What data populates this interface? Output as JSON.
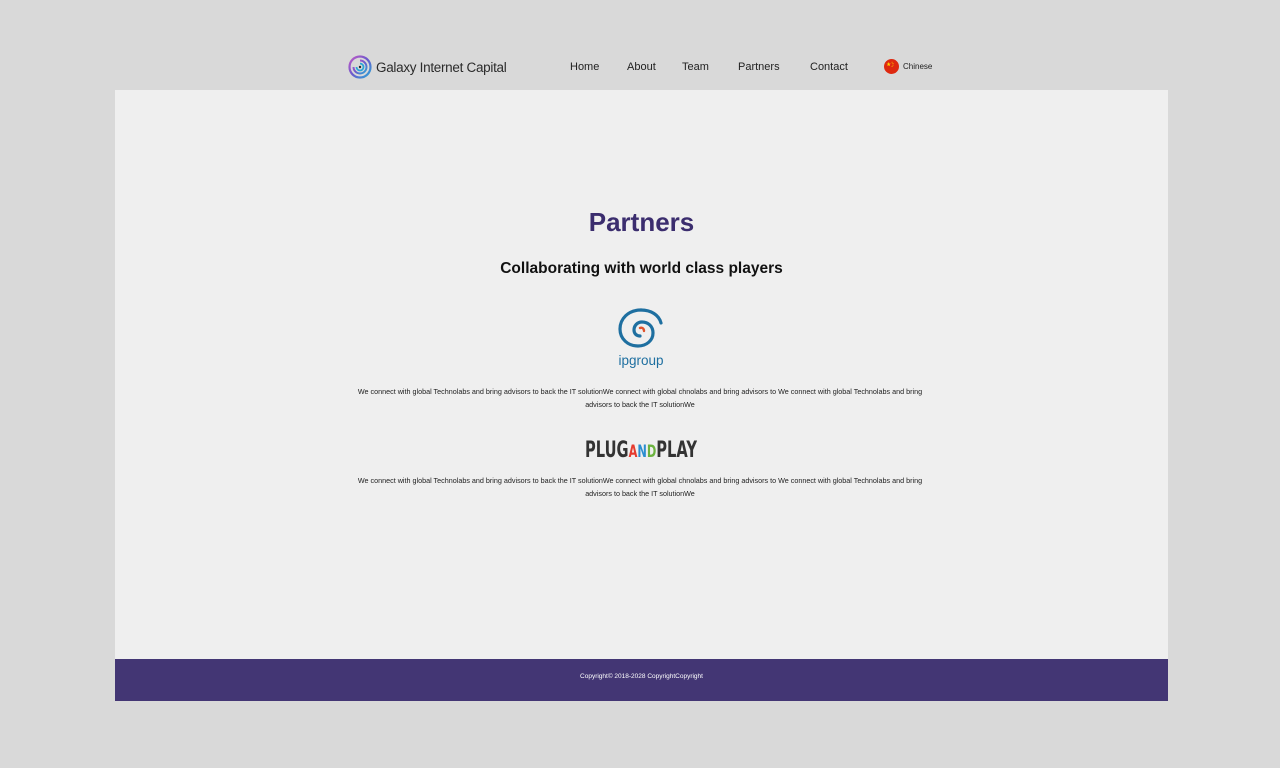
{
  "header": {
    "brand": "Galaxy Internet Capital",
    "logo_icon": "swirl-logo-icon",
    "nav": {
      "home": "Home",
      "about": "About",
      "team": "Team",
      "partners": "Partners",
      "contact": "Contact"
    },
    "language": {
      "label": "Chinese",
      "icon": "china-flag-icon"
    }
  },
  "main": {
    "title": "Partners",
    "subtitle": "Collaborating with world class players",
    "partners": [
      {
        "logo_text": "ipgroup",
        "logo_icon": "ipgroup-swirl-icon",
        "description": "We connect with global Technolabs and bring advisors to back the IT solutionWe connect with global chnolabs and bring advisors to We connect with global Technolabs and bring advisors to back the IT solutionWe"
      },
      {
        "logo_text": {
          "plug": "PLUG",
          "a": "A",
          "n": "N",
          "d": "D",
          "play": "PLAY"
        },
        "description": "We connect with global Technolabs and bring advisors to back the IT solutionWe connect with global chnolabs and bring advisors to We connect with global Technolabs and bring advisors to back the IT solutionWe"
      }
    ]
  },
  "footer": {
    "copyright": "Copyright© 2018-2028  CopyrightCopyright"
  },
  "colors": {
    "page_background": "#d9d9d9",
    "panel_background": "#efefef",
    "accent_purple": "#3b2d6e",
    "footer_purple": "#433674",
    "ipgroup_blue": "#1e6fa0",
    "pnp_dark": "#333333",
    "pnp_a": "#e53b2f",
    "pnp_n": "#2b8ed0",
    "pnp_d": "#6cb33f"
  }
}
